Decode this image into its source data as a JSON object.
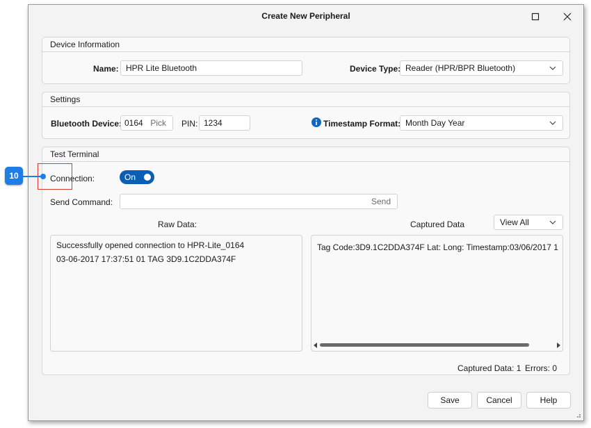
{
  "window": {
    "title": "Create New Peripheral"
  },
  "device_info": {
    "header": "Device Information",
    "name_label": "Name:",
    "name_value": "HPR Lite Bluetooth",
    "device_type_label": "Device Type:",
    "device_type_value": "Reader (HPR/BPR Bluetooth)"
  },
  "settings": {
    "header": "Settings",
    "bluetooth_label": "Bluetooth Device:",
    "bluetooth_value": "0164",
    "pick_label": "Pick",
    "pin_label": "PIN:",
    "pin_value": "1234",
    "timestamp_label": "Timestamp Format:",
    "timestamp_value": "Month Day Year"
  },
  "terminal": {
    "header": "Test Terminal",
    "connection_label": "Connection:",
    "connection_state": "On",
    "send_command_label": "Send Command:",
    "send_command_value": "",
    "send_label": "Send",
    "raw_data_label": "Raw Data:",
    "raw_lines": [
      "Successfully opened connection to HPR-Lite_0164",
      "03-06-2017 17:37:51 01 TAG 3D9.1C2DDA374F"
    ],
    "captured_label": "Captured Data",
    "view_value": "View All",
    "captured_line": "Tag Code:3D9.1C2DDA374F   Lat:   Long:   Timestamp:03/06/2017 1",
    "captured_count_label": "Captured Data: 1",
    "errors_label": "Errors: 0"
  },
  "buttons": {
    "save": "Save",
    "cancel": "Cancel",
    "help": "Help"
  },
  "annotation": {
    "number": "10"
  },
  "colors": {
    "accent": "#0a5fb4",
    "callout": "#1f7de6",
    "highlight": "#d93b2f",
    "info": "#1167c0"
  }
}
